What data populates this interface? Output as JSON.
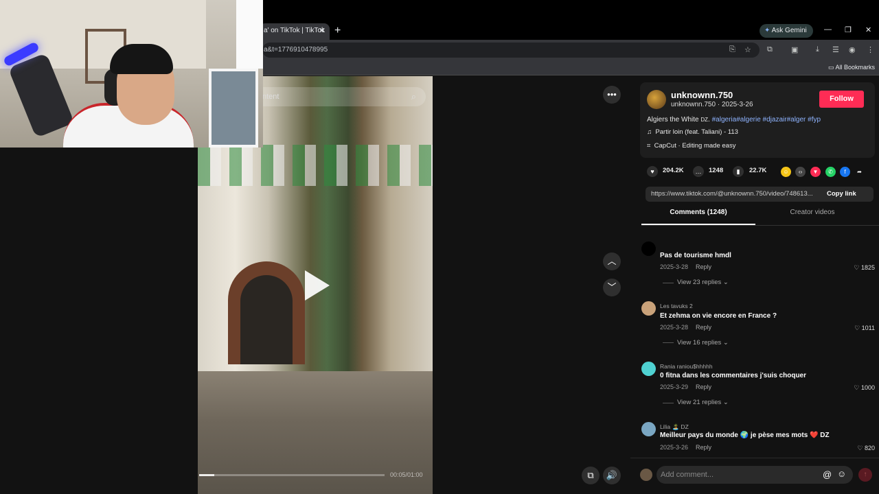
{
  "browser": {
    "tab_title": "a' on TikTok | TikTok",
    "url": "a&t=1776910478995",
    "ask_gemini": "Ask Gemini",
    "all_bookmarks": "All Bookmarks"
  },
  "video": {
    "search_placeholder": "ntent",
    "time": "00:05/01:00",
    "progress": 0.08
  },
  "author": {
    "username": "unknownn.750",
    "subline": "unknownn.750 · 2025-3-26",
    "follow_label": "Follow",
    "caption_text": "Algiers the White",
    "caption_flag": "DZ",
    "caption_tags": "#algeria#algerie #djazair#alger #fyp",
    "music": "Partir loin (feat. Taliani) - 113",
    "capcut": "CapCut · Editing made easy"
  },
  "stats": {
    "likes": "204.2K",
    "comments": "1248",
    "saves": "22.7K"
  },
  "share": {
    "link": "https://www.tiktok.com/@unknownn.750/video/748613...",
    "copy_label": "Copy link"
  },
  "tabs": {
    "comments": "Comments (1248)",
    "creator": "Creator videos"
  },
  "comments": [
    {
      "user": "",
      "text": "Pas de tourisme hmdl",
      "date": "2025-3-28",
      "reply": "Reply",
      "likes": "1825",
      "replies": "View 23 replies",
      "avatar_color": "#000000"
    },
    {
      "user": "Les tavuks 2",
      "text": "Et zehma on vie encore en France ?",
      "date": "2025-3-28",
      "reply": "Reply",
      "likes": "1011",
      "replies": "View 16 replies",
      "avatar_color": "#c9a27a"
    },
    {
      "user": "Rania raniou$hhhhh",
      "text": "0 fitna dans les commentaires j'suis choquer",
      "date": "2025-3-29",
      "reply": "Reply",
      "likes": "1000",
      "replies": "View 21 replies",
      "avatar_color": "#4fd1d1"
    },
    {
      "user": "Lilia 🏝️ DZ",
      "text": "Meilleur pays du monde 🌍 je pèse mes mots ❤️ DZ",
      "date": "2025-3-26",
      "reply": "Reply",
      "likes": "820",
      "replies": "",
      "avatar_color": "#7aa6c2"
    }
  ],
  "comment_bar": {
    "placeholder": "Add comment..."
  },
  "colors": {
    "accent": "#fe2c55",
    "tag": "#8fb4ff",
    "panel_bg": "#121212"
  }
}
